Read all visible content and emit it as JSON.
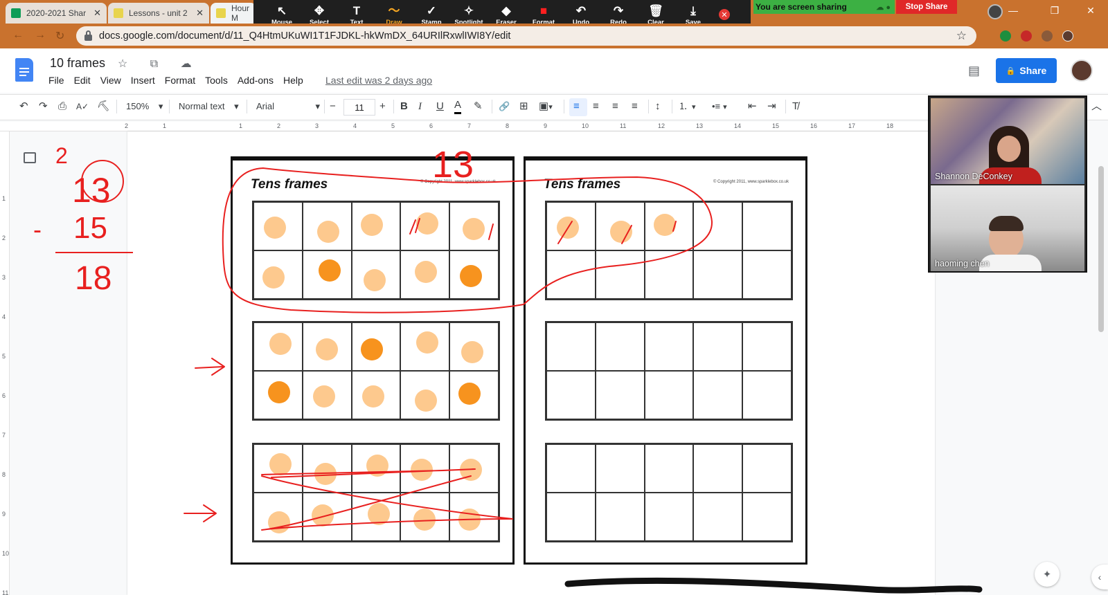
{
  "browser": {
    "tabs": [
      {
        "label": "2020-2021 Shar",
        "favicon_color": "#0f9d58"
      },
      {
        "label": "Lessons - unit 2",
        "favicon_color": "#e8d44d"
      },
      {
        "label": "Hour M",
        "favicon_color": "#e8d44d"
      }
    ],
    "url": "docs.google.com/document/d/11_Q4HtmUKuWI1T1FJDKL-hkWmDX_64URIlRxwlIWI8Y/edit",
    "tab_close_glyph": "✕",
    "star_glyph": "☆",
    "window_controls": {
      "minimize": "—",
      "restore": "❐",
      "close": "✕"
    }
  },
  "zoom_toolbar": {
    "tools": [
      {
        "name": "mouse",
        "label": "Mouse",
        "glyph": "↖"
      },
      {
        "name": "select",
        "label": "Select",
        "glyph": "✥"
      },
      {
        "name": "text",
        "label": "Text",
        "glyph": "T"
      },
      {
        "name": "draw",
        "label": "Draw",
        "glyph": "〜",
        "active": true
      },
      {
        "name": "stamp",
        "label": "Stamp",
        "glyph": "✓"
      },
      {
        "name": "spotlight",
        "label": "Spotlight",
        "glyph": "✧"
      },
      {
        "name": "eraser",
        "label": "Eraser",
        "glyph": "◆"
      },
      {
        "name": "format",
        "label": "Format",
        "glyph": "■"
      },
      {
        "name": "undo",
        "label": "Undo",
        "glyph": "↶"
      },
      {
        "name": "redo",
        "label": "Redo",
        "glyph": "↷"
      },
      {
        "name": "clear",
        "label": "Clear",
        "glyph": "🗑"
      },
      {
        "name": "save",
        "label": "Save",
        "glyph": "⤓"
      }
    ],
    "format_color": "#ff1f1f",
    "close_glyph": "✕",
    "sharing_text": "You are screen sharing",
    "stop_share_label": "Stop Share"
  },
  "docs": {
    "title": "10 frames",
    "title_icons": "☆ ⧉ ☁",
    "menu": [
      "File",
      "Edit",
      "View",
      "Insert",
      "Format",
      "Tools",
      "Add-ons",
      "Help"
    ],
    "last_edit": "Last edit was 2 days ago",
    "share_label": "Share",
    "share_glyph": "🔒",
    "comment_glyph": "▤"
  },
  "toolbar": {
    "undo": "↶",
    "redo": "↷",
    "print": "⎙",
    "spellcheck": "A✓",
    "paint_format": "⛏",
    "zoom": "150%",
    "style": "Normal text",
    "font": "Arial",
    "minus": "−",
    "font_size": "11",
    "plus": "+",
    "bold": "B",
    "italic": "I",
    "underline": "U",
    "text_color": "A",
    "highlight": "✎",
    "link": "🔗",
    "comment": "⊞",
    "image": "▣",
    "align_left": "≡",
    "align_center": "≡",
    "align_right": "≡",
    "justify": "≡",
    "line_spacing": "↕",
    "numbered_list": "⒈",
    "bulleted_list": "•≡",
    "decrease_indent": "⇤",
    "increase_indent": "⇥",
    "clear_formatting": "T̸",
    "dropdown": "▾",
    "collapse": "︿"
  },
  "ruler": {
    "horizontal": [
      "2",
      "1",
      "",
      "1",
      "2",
      "3",
      "4",
      "5",
      "6",
      "7",
      "8",
      "9",
      "10",
      "11",
      "12",
      "13",
      "14",
      "15",
      "16",
      "17",
      "18"
    ],
    "vertical": [
      "1",
      "2",
      "3",
      "4",
      "5",
      "6",
      "7",
      "8",
      "9",
      "10",
      "11"
    ]
  },
  "worksheets": [
    {
      "title": "Tens frames",
      "copyright": "© Copyright 2011, www.sparklebox.co.uk",
      "frames": [
        {
          "filled": 10,
          "dark": [
            7,
            10
          ]
        },
        {
          "filled": 10,
          "dark": [
            3,
            6,
            10
          ]
        },
        {
          "filled": 10,
          "dark": []
        }
      ]
    },
    {
      "title": "Tens frames",
      "copyright": "© Copyright 2011, www.sparklebox.co.uk",
      "frames": [
        {
          "filled": 3,
          "dark": []
        },
        {
          "filled": 0,
          "dark": []
        },
        {
          "filled": 0,
          "dark": []
        }
      ]
    }
  ],
  "annotations": {
    "ink_color": "#e8201f",
    "top_number": "13",
    "left_carry": "2",
    "left_addend_top": "13",
    "left_operator": "-",
    "left_addend_bottom": "15",
    "left_result": "18"
  },
  "participants": [
    {
      "name": "Shannon DeConkey"
    },
    {
      "name": "haoming chen"
    }
  ],
  "assist_glyph": "✦",
  "side_toggle_glyph": "‹"
}
